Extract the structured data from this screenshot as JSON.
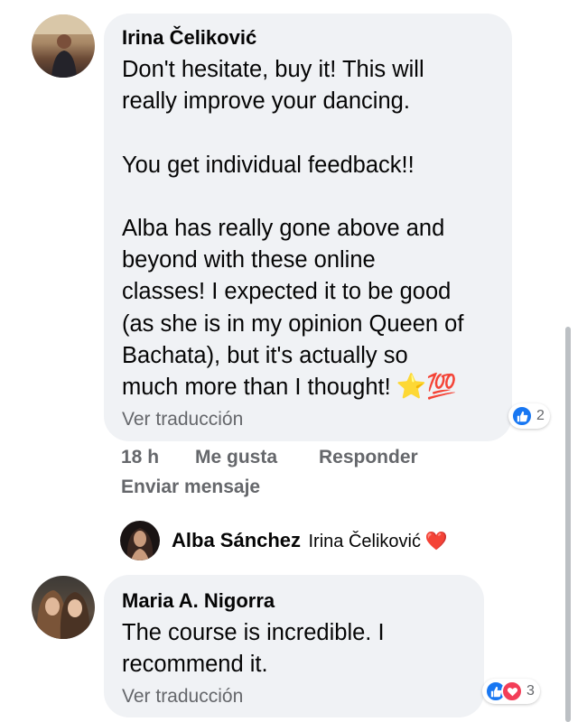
{
  "comment1": {
    "author": "Irina Čeliković",
    "text": "Don't hesitate, buy it! This will\nreally improve your dancing.\n\nYou get individual feedback!!\n\nAlba has really gone above and\nbeyond with these online\nclasses! I expected it to be good\n(as she is in my opinion Queen of\nBachata), but it's actually so\nmuch more than I thought!",
    "emoji_star": "⭐",
    "emoji_100": "💯",
    "translate_label": "Ver traducción",
    "reaction_count": "2",
    "time": "18 h",
    "like_label": "Me gusta",
    "reply_label": "Responder",
    "message_label": "Enviar mensaje"
  },
  "reply": {
    "author": "Alba Sánchez",
    "mention": "Irina Čeliković",
    "emoji_heart": "❤️"
  },
  "comment2": {
    "author": "Maria A. Nigorra",
    "text": "The course is incredible. I\nrecommend it.",
    "translate_label": "Ver traducción",
    "reaction_count": "3"
  },
  "colors": {
    "bubble": "#f0f2f5",
    "like_blue": "#1877f2",
    "love_red": "#f33e58",
    "secondary_text": "#65676b"
  }
}
